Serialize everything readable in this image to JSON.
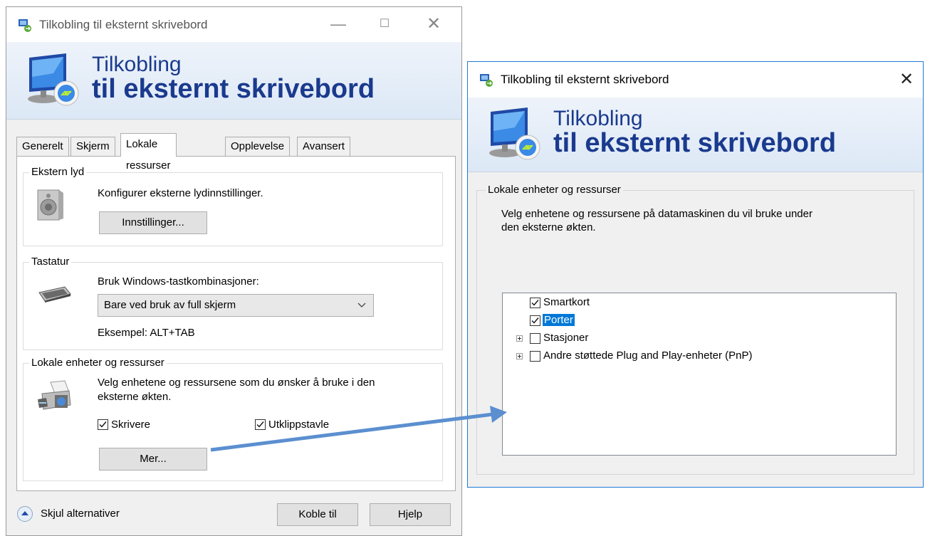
{
  "window1": {
    "title": "Tilkobling til eksternt skrivebord",
    "banner_line1": "Tilkobling",
    "banner_line2": "til eksternt skrivebord",
    "tabs": [
      "Generelt",
      "Skjerm",
      "Lokale ressurser",
      "Opplevelse",
      "Avansert"
    ],
    "active_tab": "Lokale ressurser",
    "audio": {
      "group_title": "Ekstern lyd",
      "description": "Konfigurer eksterne lydinnstillinger.",
      "button": "Innstillinger..."
    },
    "keyboard": {
      "group_title": "Tastatur",
      "description": "Bruk Windows-tastkombinasjoner:",
      "selected_option": "Bare ved bruk av full skjerm",
      "example": "Eksempel: ALT+TAB"
    },
    "local_devices": {
      "group_title": "Lokale enheter og ressurser",
      "description_line1": "Velg enhetene og ressursene som du ønsker å bruke i den",
      "description_line2": "eksterne økten.",
      "printers_label": "Skrivere",
      "printers_checked": true,
      "clipboard_label": "Utklippstavle",
      "clipboard_checked": true,
      "more_button": "Mer..."
    },
    "footer": {
      "hide_options": "Skjul alternativer",
      "connect_button": "Koble til",
      "help_button": "Hjelp"
    }
  },
  "window2": {
    "title": "Tilkobling til eksternt skrivebord",
    "banner_line1": "Tilkobling",
    "banner_line2": "til eksternt skrivebord",
    "group_title": "Lokale enheter og ressurser",
    "description_line1": "Velg enhetene og ressursene på datamaskinen du vil bruke under",
    "description_line2": "den eksterne økten.",
    "tree_items": [
      {
        "label": "Smartkort",
        "checked": true,
        "expandable": false,
        "selected": false
      },
      {
        "label": "Porter",
        "checked": true,
        "expandable": false,
        "selected": true
      },
      {
        "label": "Stasjoner",
        "checked": false,
        "expandable": true,
        "selected": false
      },
      {
        "label": "Andre støttede Plug and Play-enheter (PnP)",
        "checked": false,
        "expandable": true,
        "selected": false
      }
    ]
  },
  "colors": {
    "banner_text": "#1a3a8e",
    "arrow": "#5b8fd0",
    "selection": "#0078d7"
  }
}
